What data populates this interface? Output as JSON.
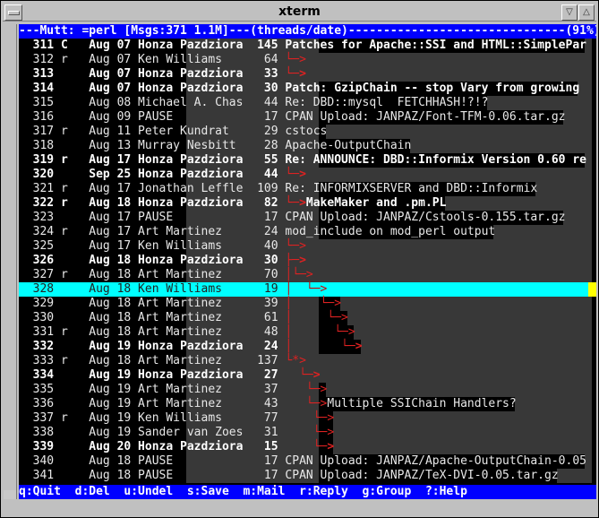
{
  "window": {
    "title": "xterm"
  },
  "status_line": "---Mutt: =perl [Msgs:371 1.1M]---(threads/date)-------------------------------(91%)---",
  "rows": [
    {
      "num": "311",
      "flag": "C",
      "date": "Aug 07",
      "from": "Honza Pazdziora",
      "size": "145",
      "tree": "",
      "subject": "Patches for Apache::SSI and HTML::SimplePar",
      "bold": true,
      "level": 0
    },
    {
      "num": "312",
      "flag": "r",
      "date": "Aug 07",
      "from": "Ken Williams",
      "size": "64",
      "tree": "└─>",
      "subject": "",
      "bold": false,
      "level": 0
    },
    {
      "num": "313",
      "flag": "",
      "date": "Aug 07",
      "from": "Honza Pazdziora",
      "size": "33",
      "tree": "└─>",
      "subject": "",
      "bold": true,
      "level": 1
    },
    {
      "num": "314",
      "flag": "",
      "date": "Aug 07",
      "from": "Honza Pazdziora",
      "size": "30",
      "tree": "",
      "subject": "Patch: GzipChain -- stop Vary from growing",
      "bold": true,
      "level": 0
    },
    {
      "num": "315",
      "flag": "",
      "date": "Aug 08",
      "from": "Michael A. Chas",
      "size": "44",
      "tree": "",
      "subject": "Re: DBD::mysql  FETCHHASH!?!?",
      "bold": false,
      "level": 0
    },
    {
      "num": "316",
      "flag": "",
      "date": "Aug 09",
      "from": "PAUSE",
      "size": "17",
      "tree": "",
      "subject": "CPAN Upload: JANPAZ/Font-TFM-0.06.tar.gz",
      "bold": false,
      "level": 0
    },
    {
      "num": "317",
      "flag": "r",
      "date": "Aug 11",
      "from": "Peter Kundrat",
      "size": "29",
      "tree": "",
      "subject": "cstocs",
      "bold": false,
      "level": 0
    },
    {
      "num": "318",
      "flag": "",
      "date": "Aug 13",
      "from": "Murray Nesbitt",
      "size": "28",
      "tree": "",
      "subject": "Apache-OutputChain",
      "bold": false,
      "level": 0
    },
    {
      "num": "319",
      "flag": "r",
      "date": "Aug 17",
      "from": "Honza Pazdziora",
      "size": "55",
      "tree": "",
      "subject": "Re: ANNOUNCE: DBD::Informix Version 0.60 re",
      "bold": true,
      "level": 0
    },
    {
      "num": "320",
      "flag": "",
      "date": "Sep 25",
      "from": "Honza Pazdziora",
      "size": "44",
      "tree": "└─>",
      "subject": "",
      "bold": true,
      "level": 0
    },
    {
      "num": "321",
      "flag": "r",
      "date": "Aug 17",
      "from": "Jonathan Leffle",
      "size": "109",
      "tree": "",
      "subject": "Re: INFORMIXSERVER and DBD::Informix",
      "bold": false,
      "level": 0
    },
    {
      "num": "322",
      "flag": "r",
      "date": "Aug 18",
      "from": "Honza Pazdziora",
      "size": "82",
      "tree": "└─>",
      "subject": "MakeMaker and .pm.PL",
      "bold": true,
      "level": 0
    },
    {
      "num": "323",
      "flag": "",
      "date": "Aug 17",
      "from": "PAUSE",
      "size": "17",
      "tree": "",
      "subject": "CPAN Upload: JANPAZ/Cstools-0.155.tar.gz",
      "bold": false,
      "level": 0
    },
    {
      "num": "324",
      "flag": "r",
      "date": "Aug 17",
      "from": "Art Martinez",
      "size": "24",
      "tree": "",
      "subject": "mod_include on mod_perl output",
      "bold": false,
      "level": 0
    },
    {
      "num": "325",
      "flag": "",
      "date": "Aug 17",
      "from": "Ken Williams",
      "size": "40",
      "tree": "└─>",
      "subject": "",
      "bold": false,
      "level": 0
    },
    {
      "num": "326",
      "flag": "",
      "date": "Aug 18",
      "from": "Honza Pazdziora",
      "size": "30",
      "tree": "├─>",
      "subject": "",
      "bold": true,
      "level": 0
    },
    {
      "num": "327",
      "flag": "r",
      "date": "Aug 18",
      "from": "Art Martinez",
      "size": "70",
      "tree": "│└─>",
      "subject": "",
      "bold": false,
      "level": 0
    },
    {
      "num": "328",
      "flag": "",
      "date": "Aug 18",
      "from": "Ken Williams",
      "size": "19",
      "tree": "│  └─>",
      "subject": "",
      "bold": false,
      "level": 0,
      "selected": true
    },
    {
      "num": "329",
      "flag": "",
      "date": "Aug 18",
      "from": "Art Martinez",
      "size": "39",
      "tree": "│    └─>",
      "subject": "",
      "bold": false,
      "level": 0
    },
    {
      "num": "330",
      "flag": "",
      "date": "Aug 18",
      "from": "Art Martinez",
      "size": "61",
      "tree": "│     └─>",
      "subject": "",
      "bold": false,
      "level": 0
    },
    {
      "num": "331",
      "flag": "r",
      "date": "Aug 18",
      "from": "Art Martinez",
      "size": "48",
      "tree": "│      └─>",
      "subject": "",
      "bold": false,
      "level": 0
    },
    {
      "num": "332",
      "flag": "",
      "date": "Aug 19",
      "from": "Honza Pazdziora",
      "size": "24",
      "tree": "│       └─>",
      "subject": "",
      "bold": true,
      "level": 0
    },
    {
      "num": "333",
      "flag": "r",
      "date": "Aug 18",
      "from": "Art Martinez",
      "size": "137",
      "tree": "└*>",
      "subject": "",
      "bold": false,
      "level": 0
    },
    {
      "num": "334",
      "flag": "",
      "date": "Aug 19",
      "from": "Honza Pazdziora",
      "size": "27",
      "tree": "  └─>",
      "subject": "",
      "bold": true,
      "level": 0
    },
    {
      "num": "335",
      "flag": "",
      "date": "Aug 19",
      "from": "Art Martinez",
      "size": "37",
      "tree": "   └─>",
      "subject": "",
      "bold": false,
      "level": 0
    },
    {
      "num": "336",
      "flag": "",
      "date": "Aug 19",
      "from": "Art Martinez",
      "size": "43",
      "tree": "   └─>",
      "subject": "Multiple SSIChain Handlers?",
      "bold": false,
      "level": 0
    },
    {
      "num": "337",
      "flag": "r",
      "date": "Aug 19",
      "from": "Ken Williams",
      "size": "77",
      "tree": "    └─>",
      "subject": "",
      "bold": false,
      "level": 0
    },
    {
      "num": "338",
      "flag": "",
      "date": "Aug 19",
      "from": "Sander van Zoes",
      "size": "31",
      "tree": "    └─>",
      "subject": "",
      "bold": false,
      "level": 0
    },
    {
      "num": "339",
      "flag": "",
      "date": "Aug 20",
      "from": "Honza Pazdziora",
      "size": "15",
      "tree": "    └─>",
      "subject": "",
      "bold": true,
      "level": 0
    },
    {
      "num": "340",
      "flag": "",
      "date": "Aug 18",
      "from": "PAUSE",
      "size": "17",
      "tree": "",
      "subject": "CPAN Upload: JANPAZ/Apache-OutputChain-0.05",
      "bold": false,
      "level": 0
    },
    {
      "num": "341",
      "flag": "",
      "date": "Aug 18",
      "from": "PAUSE",
      "size": "17",
      "tree": "",
      "subject": "CPAN Upload: JANPAZ/TeX-DVI-0.05.tar.gz",
      "bold": false,
      "level": 0
    }
  ],
  "help_line": "q:Quit  d:Del  u:Undel  s:Save  m:Mail  r:Reply  g:Group  ?:Help"
}
